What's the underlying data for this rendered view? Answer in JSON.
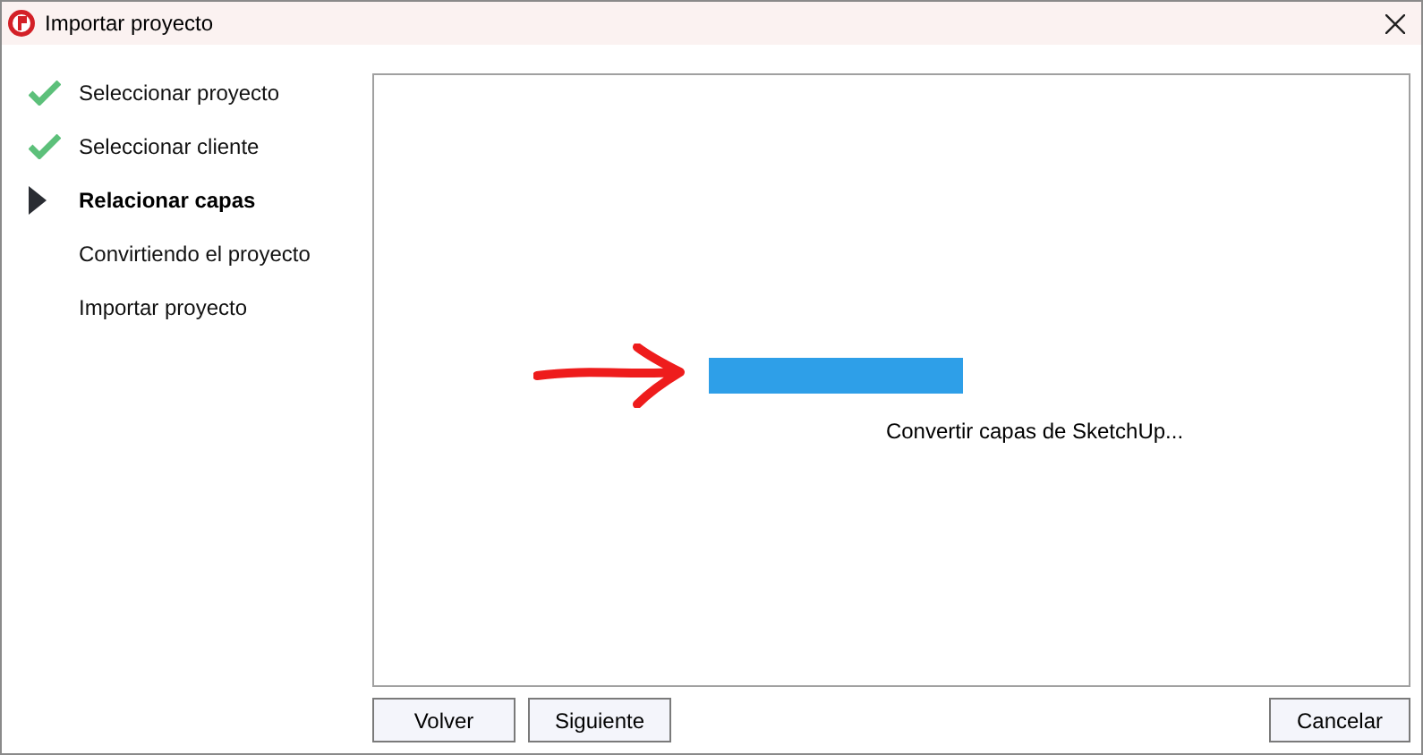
{
  "window": {
    "title": "Importar proyecto"
  },
  "steps": [
    {
      "label": "Seleccionar proyecto",
      "done": true,
      "selected": false
    },
    {
      "label": "Seleccionar cliente",
      "done": true,
      "selected": false
    },
    {
      "label": "Relacionar capas",
      "done": false,
      "selected": true
    },
    {
      "label": "Convirtiendo el proyecto",
      "done": false,
      "selected": false
    },
    {
      "label": "Importar proyecto",
      "done": false,
      "selected": false
    }
  ],
  "progress": {
    "caption": "Convertir capas de SketchUp..."
  },
  "buttons": {
    "back": "Volver",
    "next": "Siguiente",
    "cancel": "Cancelar"
  }
}
